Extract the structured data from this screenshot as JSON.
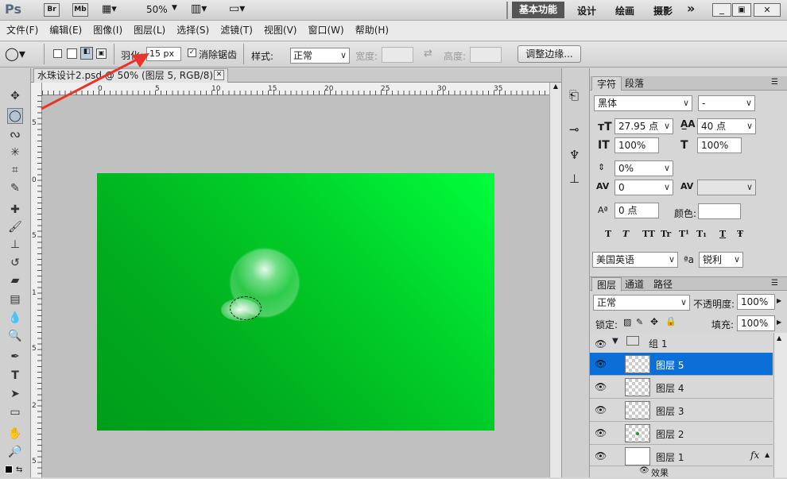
{
  "appbar": {
    "logo": "Ps",
    "br": "Br",
    "mb": "Mb",
    "zoom": "50%",
    "workspaces": [
      "基本功能",
      "设计",
      "绘画",
      "摄影"
    ],
    "more": "»"
  },
  "menu": [
    "文件(F)",
    "编辑(E)",
    "图像(I)",
    "图层(L)",
    "选择(S)",
    "滤镜(T)",
    "视图(V)",
    "窗口(W)",
    "帮助(H)"
  ],
  "options": {
    "feather_label": "羽化:",
    "feather_value": "15 px",
    "antialias_label": "消除锯齿",
    "style_label": "样式:",
    "style_value": "正常",
    "width_label": "宽度:",
    "height_label": "高度:",
    "refine_button": "调整边缘..."
  },
  "document": {
    "tab_title": "水珠设计2.psd @ 50% (图层 5, RGB/8) *",
    "close": "✕"
  },
  "ruler_h": [
    "0",
    "5",
    "10",
    "15",
    "20",
    "25",
    "30",
    "35"
  ],
  "ruler_v": [
    "5",
    "0",
    "5",
    "1",
    "5",
    "2",
    "5"
  ],
  "character": {
    "tabs": [
      "字符",
      "段落"
    ],
    "font_family": "黑体",
    "font_style": "-",
    "size": "27.95 点",
    "leading": "40 点",
    "vscale": "100%",
    "hscale": "100%",
    "tracking_pct": "0%",
    "kerning": "0",
    "tracking": "",
    "baseline": "0 点",
    "color_label": "颜色:",
    "style_buttons": [
      "T",
      "T",
      "TT",
      "Tr",
      "T¹",
      "T₁",
      "T",
      "Ŧ"
    ],
    "language": "美国英语",
    "aa_label": "ªa",
    "antialias": "锐利"
  },
  "layers": {
    "tabs": [
      "图层",
      "通道",
      "路径"
    ],
    "blend": "正常",
    "opacity_label": "不透明度:",
    "opacity": "100%",
    "lock_label": "锁定:",
    "fill_label": "填充:",
    "fill": "100%",
    "group": "组 1",
    "items": [
      "图层 5",
      "图层 4",
      "图层 3",
      "图层 2",
      "图层 1"
    ],
    "fx": "fx",
    "effects": "效果"
  }
}
